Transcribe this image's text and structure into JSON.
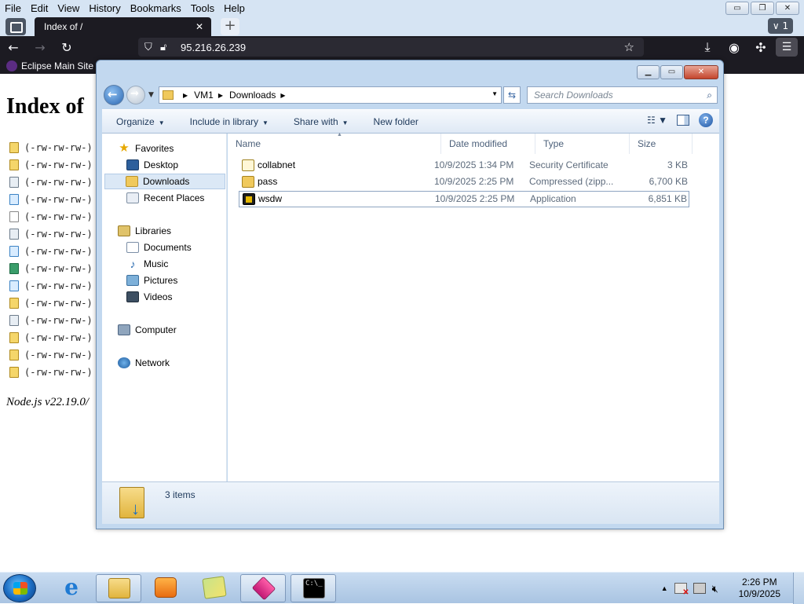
{
  "firefox": {
    "menu": [
      "File",
      "Edit",
      "View",
      "History",
      "Bookmarks",
      "Tools",
      "Help"
    ],
    "tab_title": "Index of /",
    "tab_close": "✕",
    "new_tab": "+",
    "all_tabs": "∨ 1",
    "url": "95.216.26.239",
    "bookmark": "Eclipse Main Site",
    "window_buttons": [
      "▭",
      "❐",
      "✕"
    ]
  },
  "page": {
    "heading": "Index of",
    "listing_perm": "(-rw-rw-rw-)",
    "listing_tails": [
      "(",
      "(",
      "(",
      "(",
      ")",
      "(",
      "(",
      "(",
      "(",
      "(",
      "(",
      "(",
      "(",
      "("
    ],
    "listing_icons": [
      "zip",
      "zip",
      "cfg",
      "doc",
      "txt",
      "cfg",
      "doc",
      "green",
      "doc",
      "zip",
      "cfg",
      "zip",
      "zip",
      "zip"
    ],
    "footer": "Node.js v22.19.0/"
  },
  "explorer": {
    "address": {
      "root": "VM1",
      "folder": "Downloads",
      "search_placeholder": "Search Downloads"
    },
    "toolbar": {
      "organize": "Organize",
      "include_in_library": "Include in library",
      "share_with": "Share with",
      "new_folder": "New folder"
    },
    "nav": {
      "favorites": "Favorites",
      "desktop": "Desktop",
      "downloads": "Downloads",
      "recent_places": "Recent Places",
      "libraries": "Libraries",
      "documents": "Documents",
      "music": "Music",
      "pictures": "Pictures",
      "videos": "Videos",
      "computer": "Computer",
      "network": "Network"
    },
    "columns": {
      "name": "Name",
      "date": "Date modified",
      "type": "Type",
      "size": "Size"
    },
    "files": [
      {
        "name": "collabnet",
        "date": "10/9/2025 1:34 PM",
        "type": "Security Certificate",
        "size": "3 KB",
        "icon": "cert-icon"
      },
      {
        "name": "pass",
        "date": "10/9/2025 2:25 PM",
        "type": "Compressed (zipp...",
        "size": "6,700 KB",
        "icon": "zip-folder-icon"
      },
      {
        "name": "wsdw",
        "date": "10/9/2025 2:25 PM",
        "type": "Application",
        "size": "6,851 KB",
        "icon": "application-icon"
      }
    ],
    "status": "3 items"
  },
  "taskbar": {
    "time": "2:26 PM",
    "date": "10/9/2025",
    "cmd_glyph": "C:\\_"
  },
  "colors": {
    "firefox_dark": "#1c1b22",
    "win7_chrome": "#c2d8ef",
    "selection": "#dbe8f6"
  }
}
